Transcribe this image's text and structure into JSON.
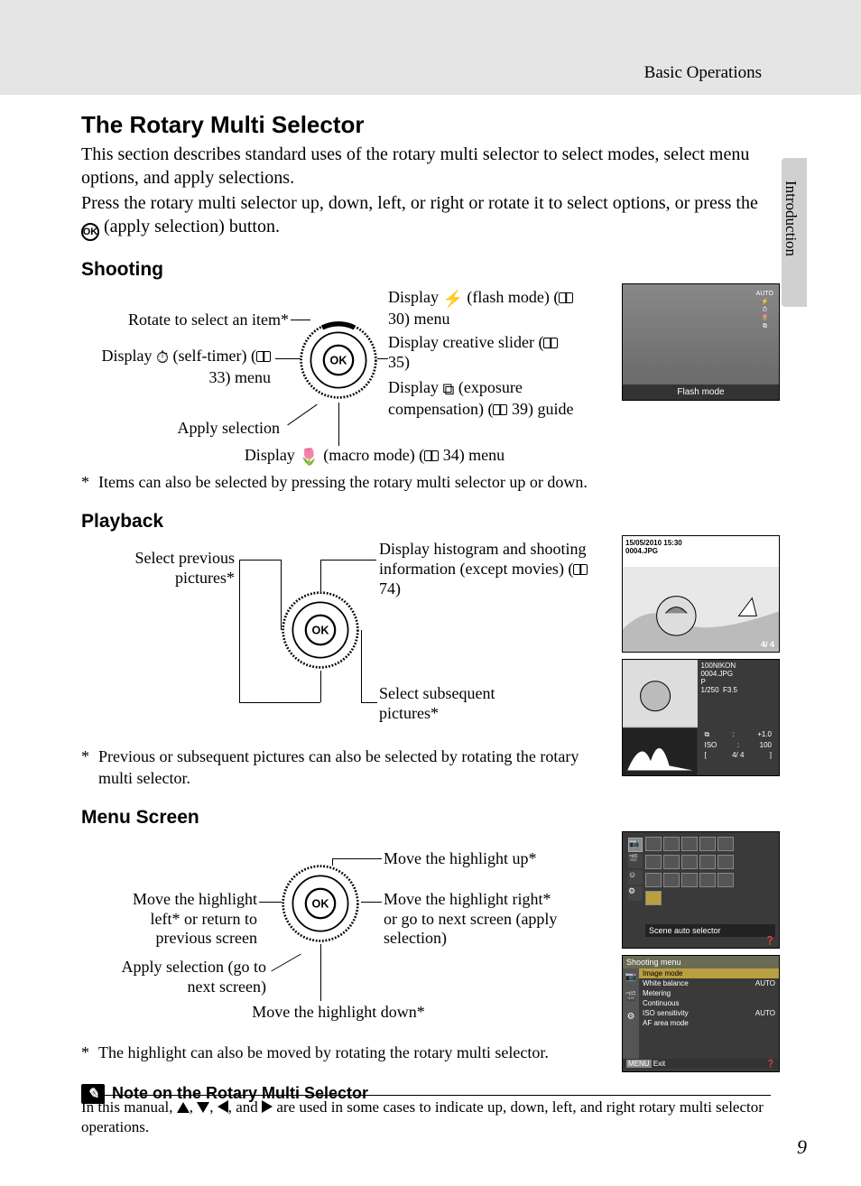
{
  "header": {
    "section": "Basic Operations"
  },
  "sidetab": {
    "label": "Introduction"
  },
  "title": "The Rotary Multi Selector",
  "intro1": "This section describes standard uses of the rotary multi selector to select modes, select menu options, and apply selections.",
  "intro2_a": "Press the rotary multi selector up, down, left, or right or rotate it to select options, or press the ",
  "intro2_b": " (apply selection) button.",
  "shooting": {
    "heading": "Shooting",
    "rotate": "Rotate to select an item*",
    "selftimer_a": "Display ",
    "selftimer_b": " (self-timer) (",
    "selftimer_c": " 33) menu",
    "apply": "Apply selection",
    "macro_a": "Display ",
    "macro_b": " (macro mode) (",
    "macro_c": " 34) menu",
    "flash_a": "Display ",
    "flash_b": " (flash mode) (",
    "flash_c": " 30) menu",
    "creative_a": "Display creative slider (",
    "creative_b": " 35)",
    "exp_a": "Display ",
    "exp_b": " (exposure compensation) (",
    "exp_c": " 39) guide",
    "footnote": "Items can also be selected by pressing the rotary multi selector up or down.",
    "screen_label": "Flash mode"
  },
  "playback": {
    "heading": "Playback",
    "prev": "Select previous pictures*",
    "hist_a": "Display histogram and shooting information (except movies) (",
    "hist_b": " 74)",
    "next": "Select subsequent pictures*",
    "footnote": "Previous or subsequent pictures can also be selected by rotating the rotary multi selector.",
    "screen1": {
      "date": "15/05/2010 15:30",
      "file": "0004.JPG",
      "count": "4/ 4"
    },
    "screen2": {
      "folder": "100NIKON",
      "file": "0004.JPG",
      "mode": "P",
      "shutter": "1/250",
      "ap": "F3.5",
      "ev": "+1.0",
      "iso": "100",
      "count": "4/ 4"
    }
  },
  "menu": {
    "heading": "Menu Screen",
    "up": "Move the highlight up*",
    "left": "Move the highlight left* or return to previous screen",
    "apply": "Apply selection (go to next screen)",
    "down": "Move the highlight down*",
    "right": "Move the highlight right* or go to next screen (apply selection)",
    "footnote": "The highlight can also be moved by rotating the rotary multi selector.",
    "screen1_label": "Scene auto selector",
    "screen2": {
      "title": "Shooting menu",
      "items": [
        "Image mode",
        "White balance",
        "Metering",
        "Continuous",
        "ISO sensitivity",
        "AF area mode"
      ],
      "vals": [
        "",
        "AUTO",
        "",
        "",
        "AUTO",
        ""
      ],
      "exit": "Exit"
    }
  },
  "note": {
    "title": "Note on the Rotary Multi Selector",
    "body_a": "In this manual, ",
    "body_b": " are used in some cases to indicate up, down, left, and right rotary multi selector operations."
  },
  "page": "9"
}
